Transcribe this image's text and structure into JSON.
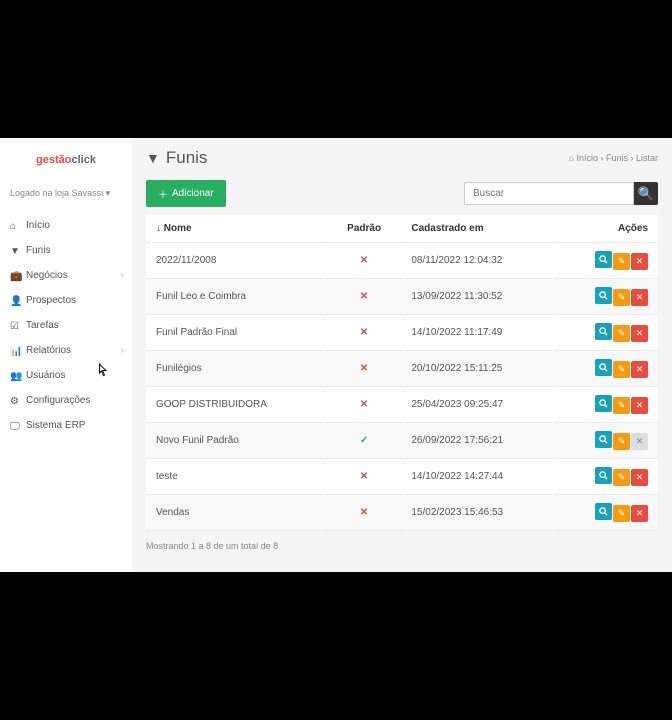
{
  "logo": {
    "brand_a": "gestão",
    "brand_b": "click"
  },
  "store_selector": "Logado na loja Savassi",
  "nav": {
    "items": [
      {
        "label": "Início",
        "icon": "dashboard-icon",
        "expandable": false
      },
      {
        "label": "Funis",
        "icon": "funnel-icon",
        "expandable": false
      },
      {
        "label": "Negócios",
        "icon": "briefcase-icon",
        "expandable": true
      },
      {
        "label": "Prospectos",
        "icon": "user-icon",
        "expandable": false
      },
      {
        "label": "Tarefas",
        "icon": "check-icon",
        "expandable": false
      },
      {
        "label": "Relatórios",
        "icon": "chart-icon",
        "expandable": true
      },
      {
        "label": "Usuários",
        "icon": "users-icon",
        "expandable": false
      },
      {
        "label": "Configurações",
        "icon": "gear-icon",
        "expandable": false
      },
      {
        "label": "Sistema ERP",
        "icon": "screen-icon",
        "expandable": false
      }
    ]
  },
  "page": {
    "title": "Funis"
  },
  "breadcrumb": {
    "home": "Início",
    "section": "Funis",
    "current": "Listar"
  },
  "toolbar": {
    "add_label": "Adicionar"
  },
  "search": {
    "placeholder": "Buscar"
  },
  "table": {
    "headers": {
      "name": "Nome",
      "default": "Padrão",
      "created": "Cadastrado em",
      "actions": "Ações"
    },
    "rows": [
      {
        "name": "2022/11/2008",
        "default": false,
        "created": "08/11/2022 12:04:32",
        "allow_delete": true
      },
      {
        "name": "Funil Leo e Coimbra",
        "default": false,
        "created": "13/09/2022 11:30:52",
        "allow_delete": true
      },
      {
        "name": "Funil Padrão Final",
        "default": false,
        "created": "14/10/2022 11:17:49",
        "allow_delete": true
      },
      {
        "name": "Funilégios",
        "default": false,
        "created": "20/10/2022 15:11:25",
        "allow_delete": true
      },
      {
        "name": "GOOP DISTRIBUIDORA",
        "default": false,
        "created": "25/04/2023 09:25:47",
        "allow_delete": true
      },
      {
        "name": "Novo Funil Padrão",
        "default": true,
        "created": "26/09/2022 17:56:21",
        "allow_delete": false
      },
      {
        "name": "teste",
        "default": false,
        "created": "14/10/2022 14:27:44",
        "allow_delete": true
      },
      {
        "name": "Vendas",
        "default": false,
        "created": "15/02/2023 15:46:53",
        "allow_delete": true
      }
    ]
  },
  "footer": {
    "summary": "Mostrando 1 a 8 de um total de 8"
  }
}
